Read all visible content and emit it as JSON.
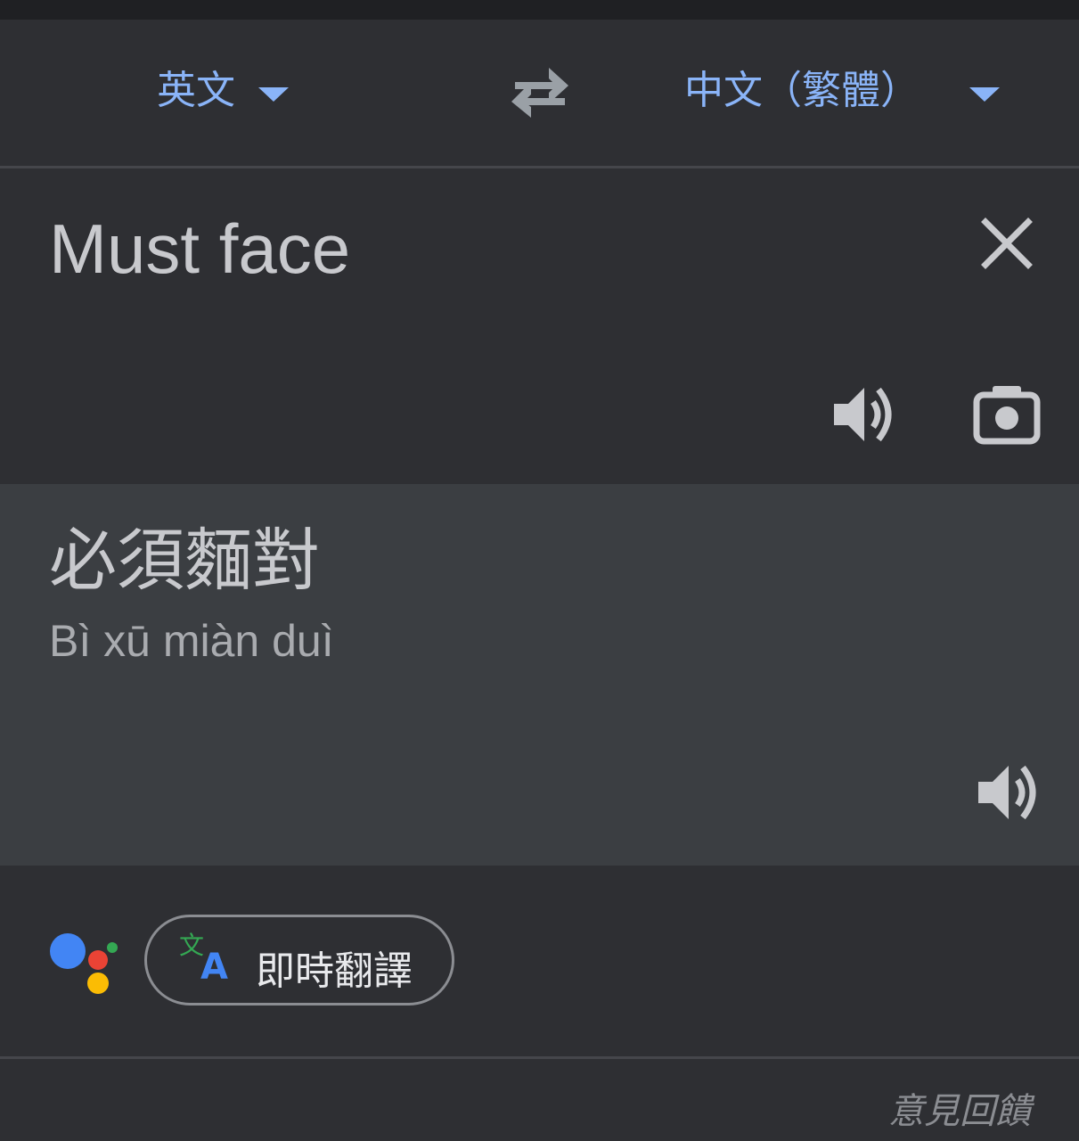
{
  "language_bar": {
    "source_language": "英文",
    "target_language": "中文（繁體）",
    "swap_icon": "swap-arrows-icon",
    "accent_color": "#8ab4f8"
  },
  "source": {
    "text": "Must face",
    "close_icon": "close-icon",
    "speaker_icon": "speaker-icon",
    "camera_icon": "camera-icon"
  },
  "result": {
    "translation": "必須麵對",
    "romanization": "Bì xū miàn duì",
    "speaker_icon": "speaker-icon"
  },
  "bottom": {
    "assistant_icon": "google-assistant-icon",
    "live_translate_label": "即時翻譯",
    "live_translate_icon": "translate-icon"
  },
  "footer": {
    "feedback_label": "意見回饋"
  }
}
